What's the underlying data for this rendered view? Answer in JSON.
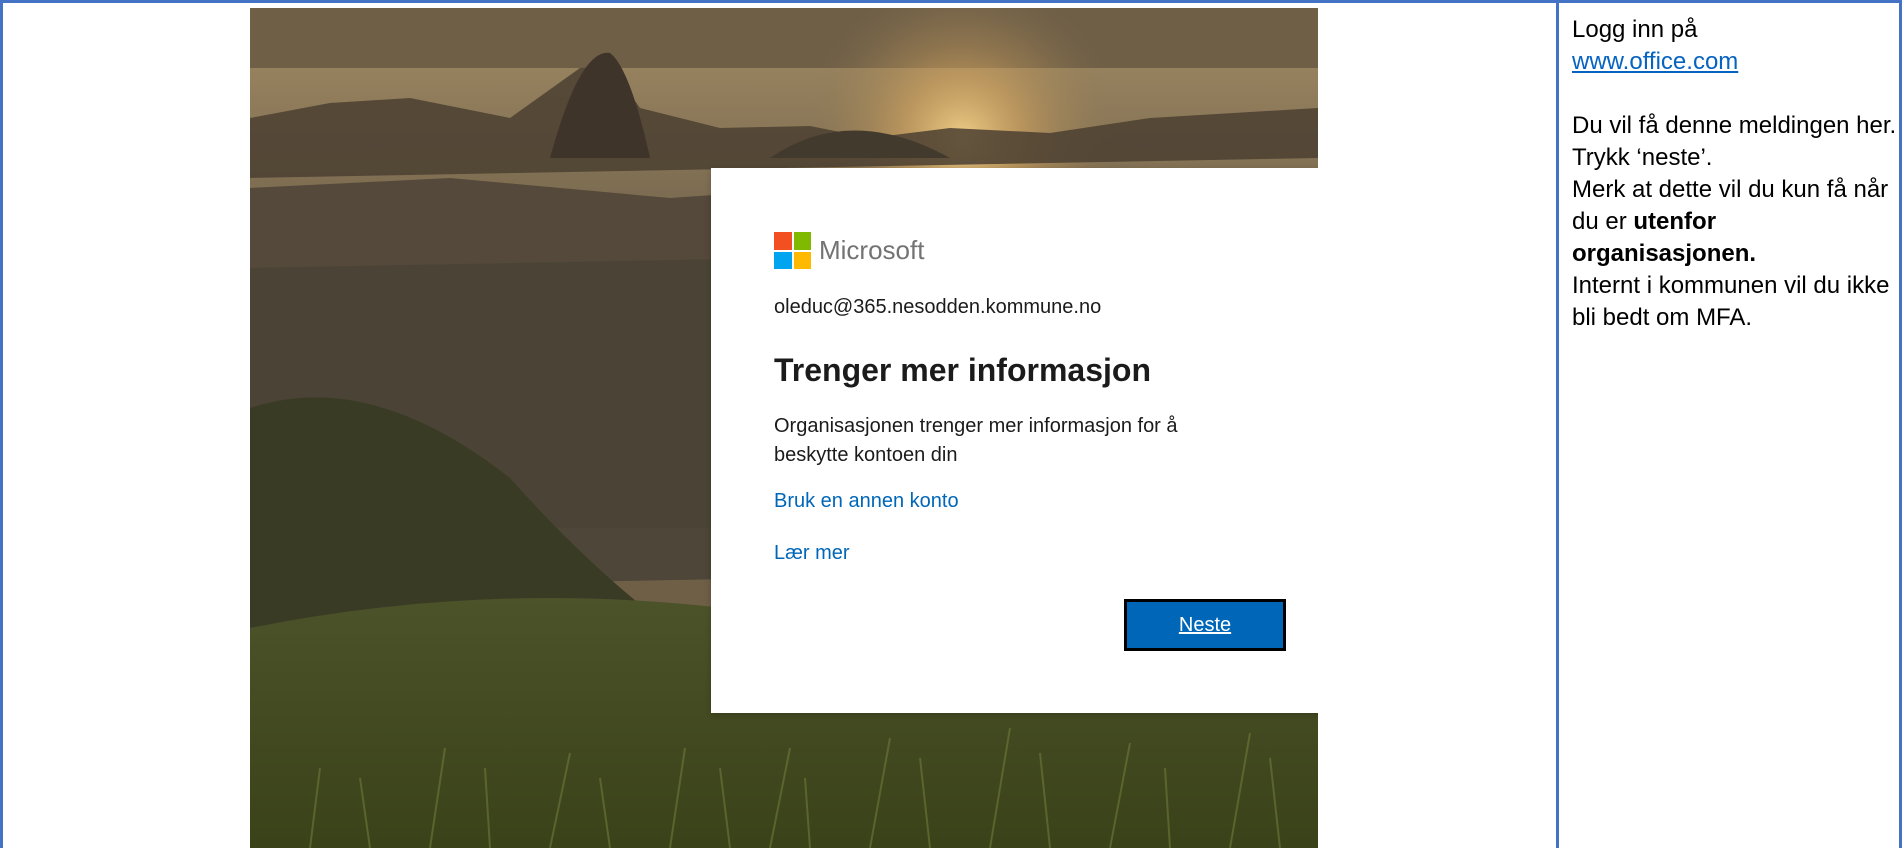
{
  "signin": {
    "brand": "Microsoft",
    "email": "oleduc@365.nesodden.kommune.no",
    "title": "Trenger mer informasjon",
    "description": "Organisasjonen trenger mer informasjon for å beskytte kontoen din",
    "link_other_account": "Bruk en annen konto",
    "link_learn_more": "Lær mer",
    "next_button": "Neste"
  },
  "notes": {
    "line1": "Logg inn på",
    "link": "www.office.com",
    "para2": "Du vil få denne meldingen her. Trykk ‘neste’.",
    "para3_start": "Merk at dette vil du kun få når du er ",
    "para3_bold": "utenfor organisasjonen.",
    "para4": "Internt i kommunen vil du ikke bli bedt om MFA."
  },
  "colors": {
    "accent_blue": "#0067b8",
    "table_border": "#4472c4",
    "ms_red": "#f25022",
    "ms_green": "#7fba00",
    "ms_blue": "#00a4ef",
    "ms_yellow": "#ffb900"
  }
}
